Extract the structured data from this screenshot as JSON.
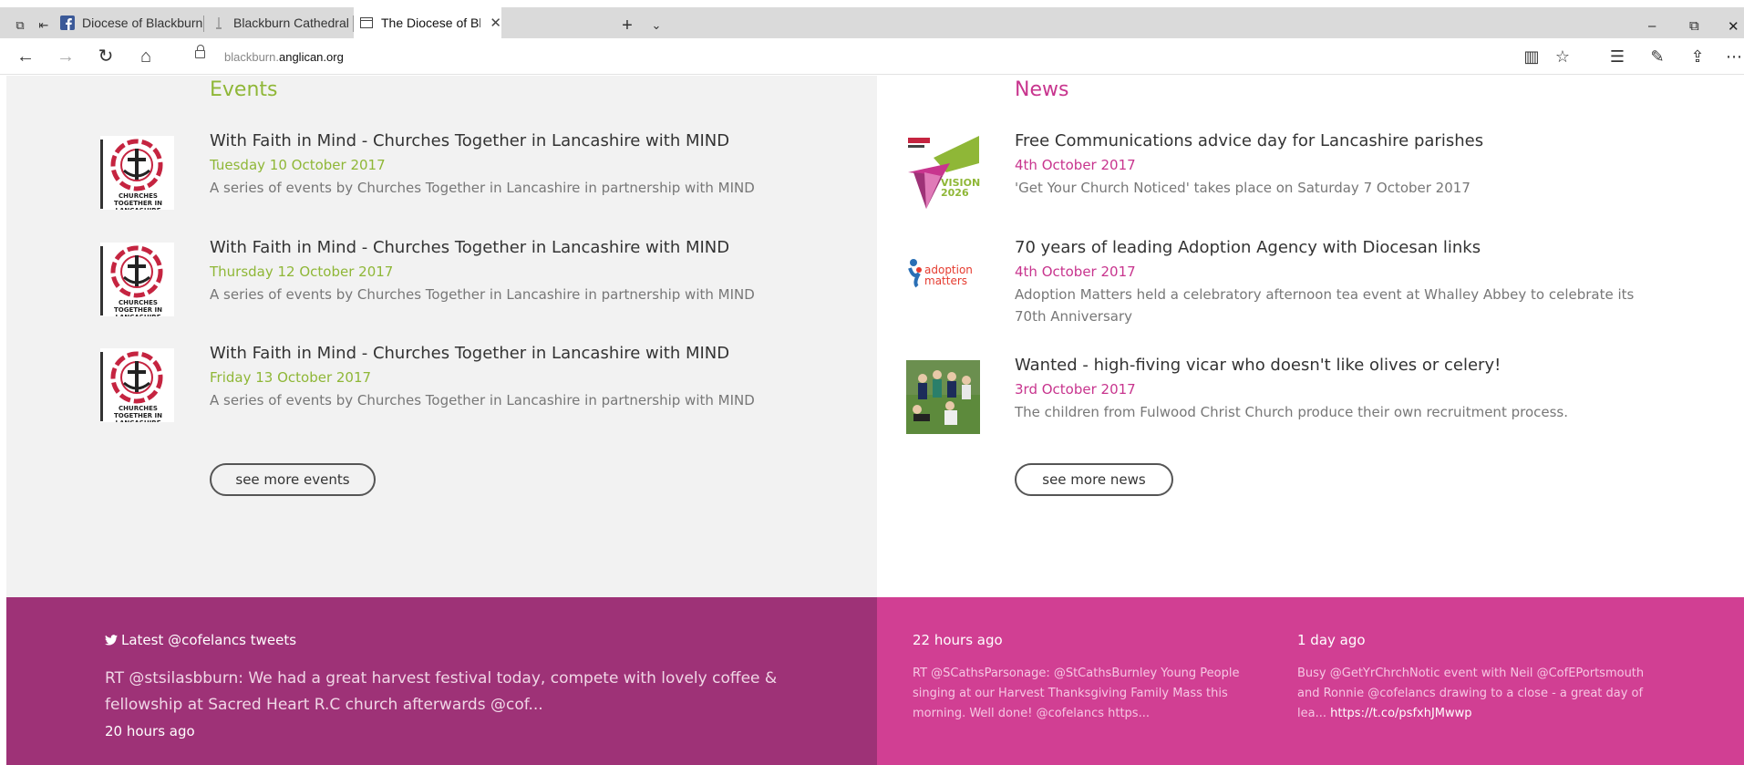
{
  "browser": {
    "tabs": [
      {
        "label": "Diocese of Blackburn Vision",
        "icon": "facebook-icon"
      },
      {
        "label": "Blackburn Cathedral | Good",
        "icon": "page-icon"
      },
      {
        "label": "The Diocese of Blackburn",
        "icon": "document-icon",
        "active": true
      }
    ],
    "url_prefix": "blackburn.",
    "url_host": "anglican.org"
  },
  "events": {
    "title": "Events",
    "items": [
      {
        "title": "With Faith in Mind - Churches Together in Lancashire with MIND",
        "date": "Tuesday 10 October 2017",
        "desc": "A series of events by Churches Together in Lancashire in partnership with MIND",
        "logo_text": "CHURCHES TOGETHER IN LANCASHIRE"
      },
      {
        "title": "With Faith in Mind - Churches Together in Lancashire with MIND",
        "date": "Thursday 12 October 2017",
        "desc": "A series of events by Churches Together in Lancashire in partnership with MIND",
        "logo_text": "CHURCHES TOGETHER IN LANCASHIRE"
      },
      {
        "title": "With Faith in Mind - Churches Together in Lancashire with MIND",
        "date": "Friday 13 October 2017",
        "desc": "A series of events by Churches Together in Lancashire in partnership with MIND",
        "logo_text": "CHURCHES TOGETHER IN LANCASHIRE"
      }
    ],
    "more_label": "see more events"
  },
  "news": {
    "title": "News",
    "items": [
      {
        "title": "Free Communications advice day for Lancashire parishes",
        "date": "4th October 2017",
        "desc": "'Get Your Church Noticed' takes place on Saturday 7 October 2017",
        "logo_text": "VISION 2026"
      },
      {
        "title": "70 years of leading Adoption Agency with Diocesan links",
        "date": "4th October 2017",
        "desc": "Adoption Matters held a celebratory afternoon tea event at Whalley Abbey to celebrate its 70th Anniversary",
        "logo_text": "adoption matters"
      },
      {
        "title": "Wanted - high-fiving vicar who doesn't like olives or celery!",
        "date": "3rd October 2017",
        "desc": "The children from Fulwood Christ Church produce their own recruitment process."
      }
    ],
    "more_label": "see more news"
  },
  "tweets": {
    "heading": "Latest @cofelancs tweets",
    "main": {
      "text": "RT @stsilasbburn: We had a great harvest festival today, compete with lovely coffee & fellowship at Sacred Heart R.C church afterwards @cof...",
      "time": "20 hours ago"
    },
    "others": [
      {
        "time": "22 hours ago",
        "text": "RT @SCathsParsonage: @StCathsBurnley Young People singing at our Harvest Thanksgiving Family Mass this morning. Well done! @cofelancs https...",
        "link": ""
      },
      {
        "time": "1 day ago",
        "text": "Busy @GetYrChrchNotic event with Neil @CofEPortsmouth and Ronnie @cofelancs drawing to a close - a great day of lea... ",
        "link": "https://t.co/psfxhJMwwp"
      }
    ]
  },
  "colors": {
    "events_accent": "#8fb737",
    "news_accent": "#c8358e",
    "footer_left": "#9e3277",
    "footer_right": "#d13f93"
  }
}
